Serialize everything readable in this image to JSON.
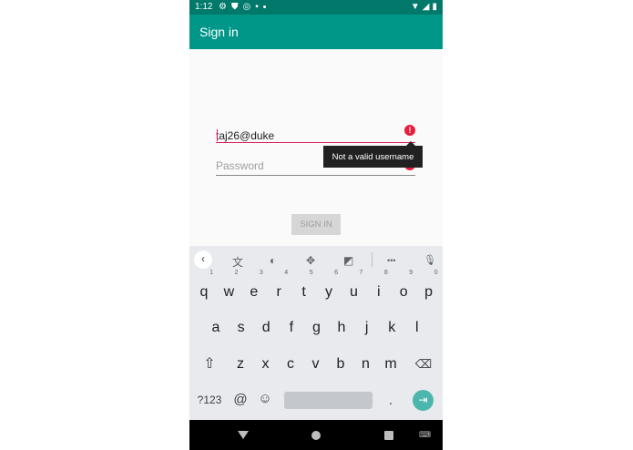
{
  "status_bar": {
    "time": "1:12"
  },
  "app_bar": {
    "title": "Sign in"
  },
  "form": {
    "username_value": "taj26@duke",
    "password_placeholder": "Password",
    "error_icon_glyph": "!",
    "error_tooltip": "Not a valid username",
    "sign_in_label": "SIGN IN"
  },
  "keyboard": {
    "toolbar": {
      "back": "‹",
      "translate": "文",
      "theme": "◐",
      "cursor": "✥",
      "clipboard": "◩",
      "more": "•••",
      "mic_off": "🎙"
    },
    "row1": [
      {
        "k": "q",
        "h": "1"
      },
      {
        "k": "w",
        "h": "2"
      },
      {
        "k": "e",
        "h": "3"
      },
      {
        "k": "r",
        "h": "4"
      },
      {
        "k": "t",
        "h": "5"
      },
      {
        "k": "y",
        "h": "6"
      },
      {
        "k": "u",
        "h": "7"
      },
      {
        "k": "i",
        "h": "8"
      },
      {
        "k": "o",
        "h": "9"
      },
      {
        "k": "p",
        "h": "0"
      }
    ],
    "row2": [
      "a",
      "s",
      "d",
      "f",
      "g",
      "h",
      "j",
      "k",
      "l"
    ],
    "row3": [
      "z",
      "x",
      "c",
      "v",
      "b",
      "n",
      "m"
    ],
    "shift": "⇧",
    "backspace": "⌫",
    "symbols": "?123",
    "at": "@",
    "emoji": "☺",
    "period": ".",
    "enter": "⇥"
  },
  "colors": {
    "status_bar": "#00796b",
    "app_bar": "#009688",
    "error": "#e91e3c",
    "accent_enter": "#4db6ac"
  }
}
